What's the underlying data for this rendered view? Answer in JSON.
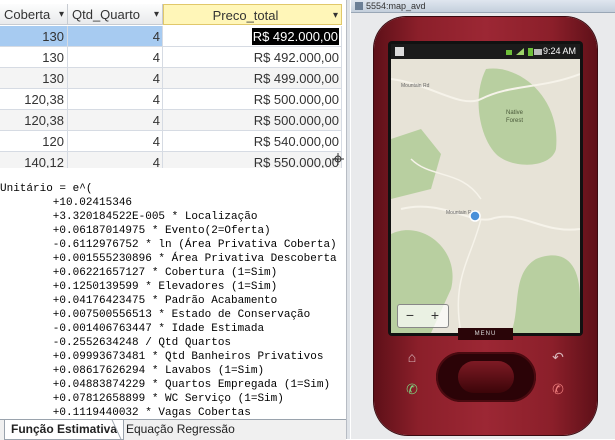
{
  "table": {
    "headers": [
      "Coberta",
      "Qtd_Quarto",
      "Preco_total"
    ],
    "dropdown_glyph": "▾",
    "rows": [
      {
        "coberta": "130",
        "qtd": "4",
        "preco": "R$ 492.000,00"
      },
      {
        "coberta": "130",
        "qtd": "4",
        "preco": "R$ 492.000,00"
      },
      {
        "coberta": "130",
        "qtd": "4",
        "preco": "R$ 499.000,00"
      },
      {
        "coberta": "120,38",
        "qtd": "4",
        "preco": "R$ 500.000,00"
      },
      {
        "coberta": "120,38",
        "qtd": "4",
        "preco": "R$ 500.000,00"
      },
      {
        "coberta": "120",
        "qtd": "4",
        "preco": "R$ 540.000,00"
      },
      {
        "coberta": "140,12",
        "qtd": "4",
        "preco": "R$ 550.000,00"
      }
    ]
  },
  "code": {
    "lines": [
      "Unitário = e^(",
      "        +10.02415346",
      "        +3.320184522E-005 * Localização",
      "        +0.06187014975 * Evento(2=Oferta)",
      "        -0.6112976752 * ln (Área Privativa Coberta)",
      "        +0.001555230896 * Área Privativa Descoberta",
      "        +0.06221657127 * Cobertura (1=Sim)",
      "        +0.1250139599 * Elevadores (1=Sim)",
      "        +0.04176423475 * Padrão Acabamento",
      "        +0.007500556513 * Estado de Conservação",
      "        -0.001406763447 * Idade Estimada",
      "        -0.2552634248 / Qtd Quartos",
      "        +0.09993673481 * Qtd Banheiros Privativos",
      "        +0.08617626294 * Lavabos (1=Sim)",
      "        +0.04883874229 * Quartos Empregada (1=Sim)",
      "        +0.07812658899 * WC Serviço (1=Sim)",
      "        +0.1119440032 * Vagas Cobertas"
    ]
  },
  "tabs": [
    {
      "label": "Função Estimativa",
      "active": true
    },
    {
      "label": "Equação Regressão",
      "active": false
    }
  ],
  "emulator": {
    "window_title": "5554:map_avd",
    "clock": "9:24 AM",
    "map_labels": {
      "native_forest_line1": "Native",
      "native_forest_line2": "Forest",
      "road1": "Mountain Rd",
      "road2": "Mountain Rd"
    },
    "zoom_out": "−",
    "zoom_in": "+",
    "menu_label": "MENU",
    "colors": {
      "phone_body": "#8b1f2a",
      "map_land": "#e7e3d7",
      "map_forest": "#b8cfa0",
      "location_dot": "#4a90d9"
    }
  }
}
